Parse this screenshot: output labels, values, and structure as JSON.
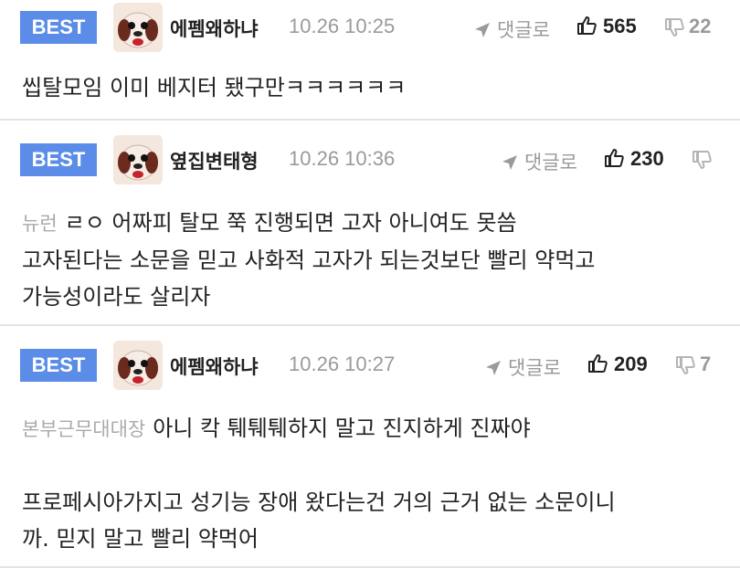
{
  "comments": [
    {
      "badge": "BEST",
      "nickname": "에펨왜하냐",
      "time": "10.26 10:25",
      "reply_label": "댓글로",
      "likes": "565",
      "dislikes": "22",
      "mention": "",
      "lines": [
        "씹탈모임 이미 베지터 됐구만ㅋㅋㅋㅋㅋㅋ"
      ]
    },
    {
      "badge": "BEST",
      "nickname": "옆집변태형",
      "time": "10.26 10:36",
      "reply_label": "댓글로",
      "likes": "230",
      "dislikes": "",
      "mention": "뉴런",
      "lines": [
        "ㄹㅇ 어짜피 탈모 쭉 진행되면 고자 아니여도 못씀",
        "고자된다는 소문을 믿고 사화적 고자가 되는것보단 빨리 약먹고",
        "가능성이라도 살리자"
      ]
    },
    {
      "badge": "BEST",
      "nickname": "에펨왜하냐",
      "time": "10.26 10:27",
      "reply_label": "댓글로",
      "likes": "209",
      "dislikes": "7",
      "mention": "본부근무대대장",
      "lines": [
        "아니 칵 퉤퉤퉤하지 말고 진지하게 진짜야",
        "",
        "프로페시아가지고 성기능 장애 왔다는건 거의 근거 없는 소문이니",
        "까. 믿지 말고 빨리 약먹어"
      ]
    }
  ],
  "colors": {
    "badge": "#5b8de8",
    "muted": "#9a9a9a",
    "text": "#222222",
    "divider": "#e3e3e3"
  },
  "icons": {
    "reply": "reply-arrow-icon",
    "like": "thumbs-up-icon",
    "dislike": "thumbs-down-icon",
    "avatar": "dog-face-avatar"
  }
}
